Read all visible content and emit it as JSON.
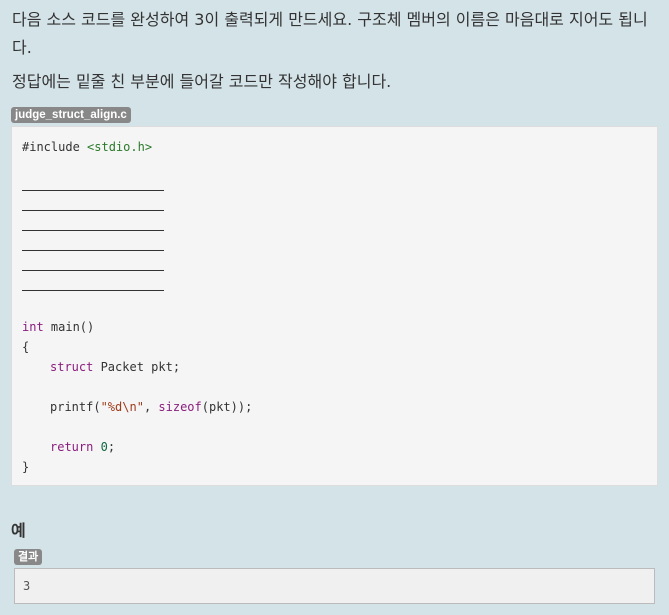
{
  "instructions": {
    "line1": "다음 소스 코드를 완성하여 3이 출력되게 만드세요. 구조체 멤버의 이름은 마음대로 지어도 됩니다.",
    "line2": "정답에는 밑줄 친 부분에 들어갈 코드만 작성해야 합니다."
  },
  "code": {
    "filename": "judge_struct_align.c",
    "include_directive": "#include",
    "include_header": "<stdio.h>",
    "blank_count": 6,
    "type_int": "int",
    "fn_main": " main()",
    "brace_open": "{",
    "kw_struct": "struct",
    "struct_decl": " Packet pkt;",
    "fn_printf": "printf(",
    "format_string": "\"%d\\n\"",
    "comma": ", ",
    "kw_sizeof": "sizeof",
    "sizeof_arg": "(pkt));",
    "kw_return": "return",
    "return_value": "0",
    "semicolon": ";",
    "brace_close": "}"
  },
  "example": {
    "title": "예",
    "result_label": "결과",
    "result_value": "3"
  }
}
